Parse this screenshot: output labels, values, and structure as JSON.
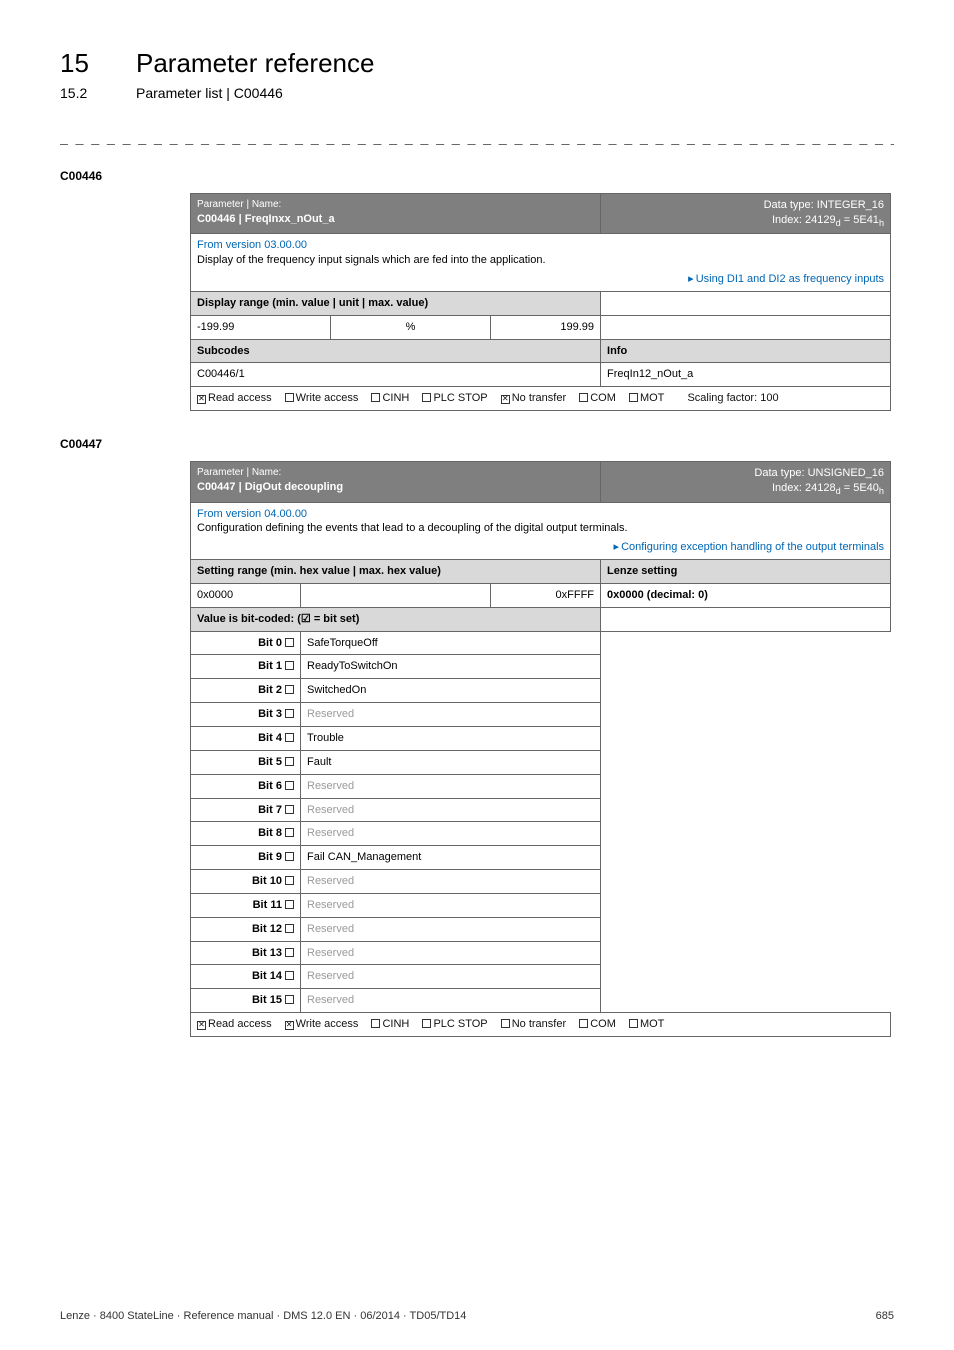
{
  "chapter": {
    "num": "15",
    "title": "Parameter reference"
  },
  "sub": {
    "num": "15.2",
    "title": "Parameter list | C00446"
  },
  "dashes": "_ _ _ _ _ _ _ _ _ _ _ _ _ _ _ _ _ _ _ _ _ _ _ _ _ _ _ _ _ _ _ _ _ _ _ _ _ _ _ _ _ _ _ _ _ _ _ _ _ _ _ _ _ _ _ _ _ _ _ _ _ _ _ _",
  "p446": {
    "id": "C00446",
    "header": {
      "left_top": "Parameter | Name:",
      "name": "C00446 | FreqInxx_nOut_a",
      "right_top": "Data type: INTEGER_16",
      "right_bot": "Index: 24129d = 5E41h",
      "right_bot_d": "d",
      "right_bot_h": "h"
    },
    "desc": {
      "version_link": "From version 03.00.00",
      "line1": "Display of the frequency input signals which are fed into the application.",
      "link": "Using DI1 and DI2 as frequency inputs"
    },
    "range_label": "Display range (min. value | unit | max. value)",
    "range": {
      "min": "-199.99",
      "unit": "%",
      "max": "199.99"
    },
    "subcodes_label": "Subcodes",
    "info_label": "Info",
    "subcode": {
      "code": "C00446/1",
      "info": "FreqIn12_nOut_a"
    },
    "footer": {
      "read": "Read access",
      "write": "Write access",
      "cinh": "CINH",
      "plc": "PLC STOP",
      "notr": "No transfer",
      "com": "COM",
      "mot": "MOT",
      "scaling": "Scaling factor: 100"
    }
  },
  "p447": {
    "id": "C00447",
    "header": {
      "left_top": "Parameter | Name:",
      "name": "C00447 | DigOut decoupling",
      "right_top": "Data type: UNSIGNED_16",
      "right_bot": "Index: 24128d = 5E40h"
    },
    "desc": {
      "version_link": "From version 04.00.00",
      "line1": "Configuration defining the events that lead to a decoupling of the digital output terminals.",
      "link": "Configuring exception handling of the output terminals"
    },
    "setting_label": "Setting range (min. hex value | max. hex value)",
    "lenze_label": "Lenze setting",
    "setting": {
      "min": "0x0000",
      "max": "0xFFFF",
      "lenze": "0x0000  (decimal: 0)"
    },
    "bitset_label": "Value is bit-coded:  (☑ = bit set)",
    "bits": [
      {
        "n": "Bit 0",
        "name": "SafeTorqueOff",
        "reserved": false
      },
      {
        "n": "Bit 1",
        "name": "ReadyToSwitchOn",
        "reserved": false
      },
      {
        "n": "Bit 2",
        "name": "SwitchedOn",
        "reserved": false
      },
      {
        "n": "Bit 3",
        "name": "Reserved",
        "reserved": true
      },
      {
        "n": "Bit 4",
        "name": "Trouble",
        "reserved": false
      },
      {
        "n": "Bit 5",
        "name": "Fault",
        "reserved": false
      },
      {
        "n": "Bit 6",
        "name": "Reserved",
        "reserved": true
      },
      {
        "n": "Bit 7",
        "name": "Reserved",
        "reserved": true
      },
      {
        "n": "Bit 8",
        "name": "Reserved",
        "reserved": true
      },
      {
        "n": "Bit 9",
        "name": "Fail CAN_Management",
        "reserved": false
      },
      {
        "n": "Bit 10",
        "name": "Reserved",
        "reserved": true
      },
      {
        "n": "Bit 11",
        "name": "Reserved",
        "reserved": true
      },
      {
        "n": "Bit 12",
        "name": "Reserved",
        "reserved": true
      },
      {
        "n": "Bit 13",
        "name": "Reserved",
        "reserved": true
      },
      {
        "n": "Bit 14",
        "name": "Reserved",
        "reserved": true
      },
      {
        "n": "Bit 15",
        "name": "Reserved",
        "reserved": true
      }
    ],
    "footer": {
      "read": "Read access",
      "write": "Write access",
      "cinh": "CINH",
      "plc": "PLC STOP",
      "notr": "No transfer",
      "com": "COM",
      "mot": "MOT"
    }
  },
  "page_footer": {
    "left": "Lenze · 8400 StateLine · Reference manual · DMS 12.0 EN · 06/2014 · TD05/TD14",
    "right": "685"
  }
}
